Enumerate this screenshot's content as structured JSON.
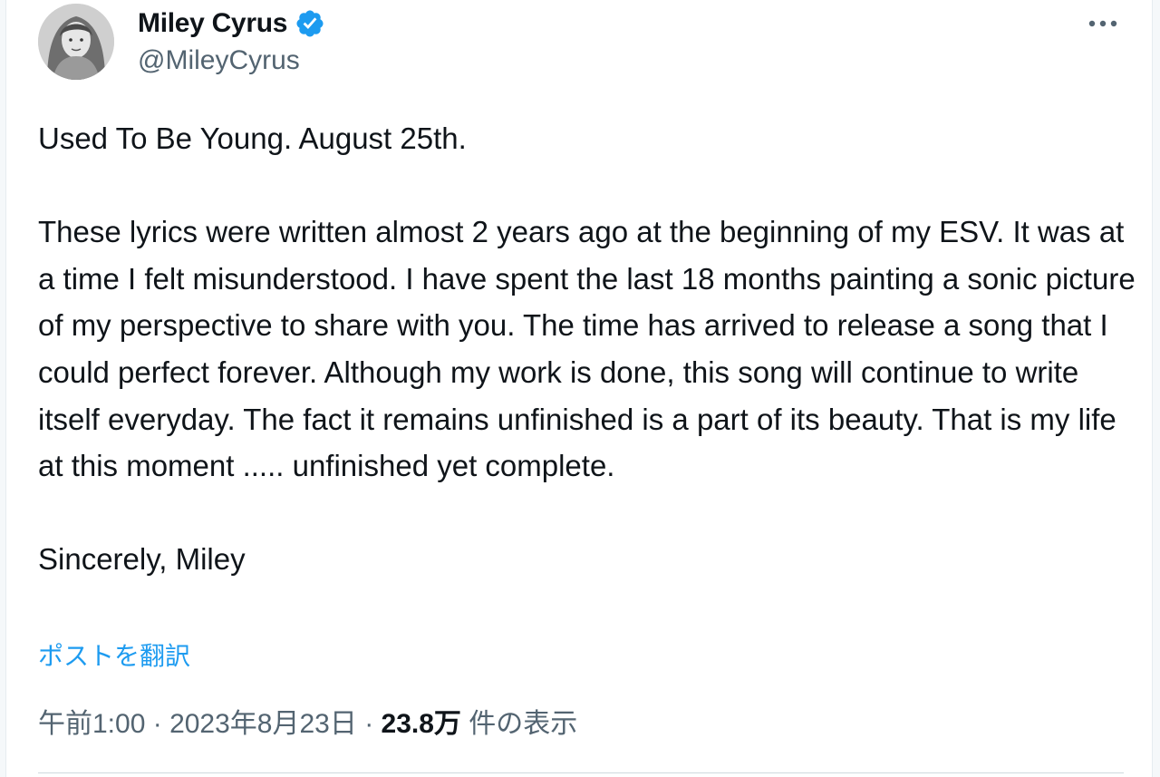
{
  "author": {
    "display_name": "Miley Cyrus",
    "handle": "@MileyCyrus",
    "verified_icon": "verified-badge-icon",
    "avatar": "avatar"
  },
  "more_icon": "more-options-icon",
  "tweet": {
    "line1": "Used To Be Young. August 25th.",
    "paragraph": "These lyrics were written almost 2 years ago at the beginning of my ESV. It was at a time I felt misunderstood. I have spent the last 18 months painting a sonic picture of my perspective to share with you. The time has arrived to release a song that I could perfect forever. Although my work is done, this song will continue to write itself everyday. The fact it remains unfinished is a part of its beauty. That is my life at this moment ..... unfinished yet complete.",
    "signoff": "Sincerely, Miley"
  },
  "translate_label": "ポストを翻訳",
  "meta": {
    "time": "午前1:00",
    "sep1": " · ",
    "date": "2023年8月23日",
    "sep2": " · ",
    "views_count": "23.8万",
    "views_label": " 件の表示"
  },
  "colors": {
    "accent": "#1d9bf0",
    "muted": "#536471",
    "text": "#0f1419"
  }
}
